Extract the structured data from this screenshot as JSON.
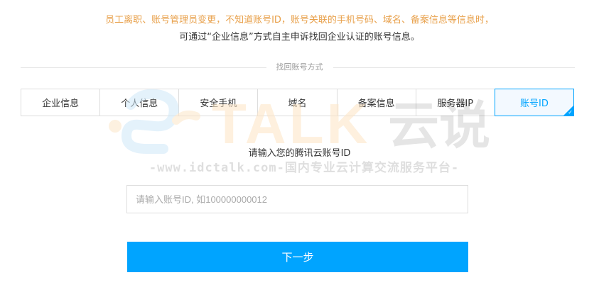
{
  "notice": {
    "line1": "员工离职、账号管理员变更，不知道账号ID，账号关联的手机号码、域名、备案信息等信息时，",
    "line2": "可通过“企业信息”方式自主申诉找回企业认证的账号信息。"
  },
  "divider_label": "找回账号方式",
  "tabs": [
    {
      "label": "企业信息",
      "active": false
    },
    {
      "label": "个人信息",
      "active": false
    },
    {
      "label": "安全手机",
      "active": false
    },
    {
      "label": "域名",
      "active": false
    },
    {
      "label": "备案信息",
      "active": false
    },
    {
      "label": "服务器IP",
      "active": false
    },
    {
      "label": "账号ID",
      "active": true
    }
  ],
  "form": {
    "prompt": "请输入您的腾讯云账号ID",
    "input_value": "",
    "input_placeholder": "请输入账号ID, 如100000000012",
    "next_label": "下一步"
  },
  "watermark": {
    "brand": "TALK",
    "brand_cn": "云说",
    "url_text": "-www.idctalk.com-国内专业云计算交流服务平台-"
  },
  "colors": {
    "accent": "#00a4ff",
    "notice": "#e8a04a",
    "active_tab_bg": "#f3f9ff",
    "watermark_accent": "#fde6c8"
  }
}
